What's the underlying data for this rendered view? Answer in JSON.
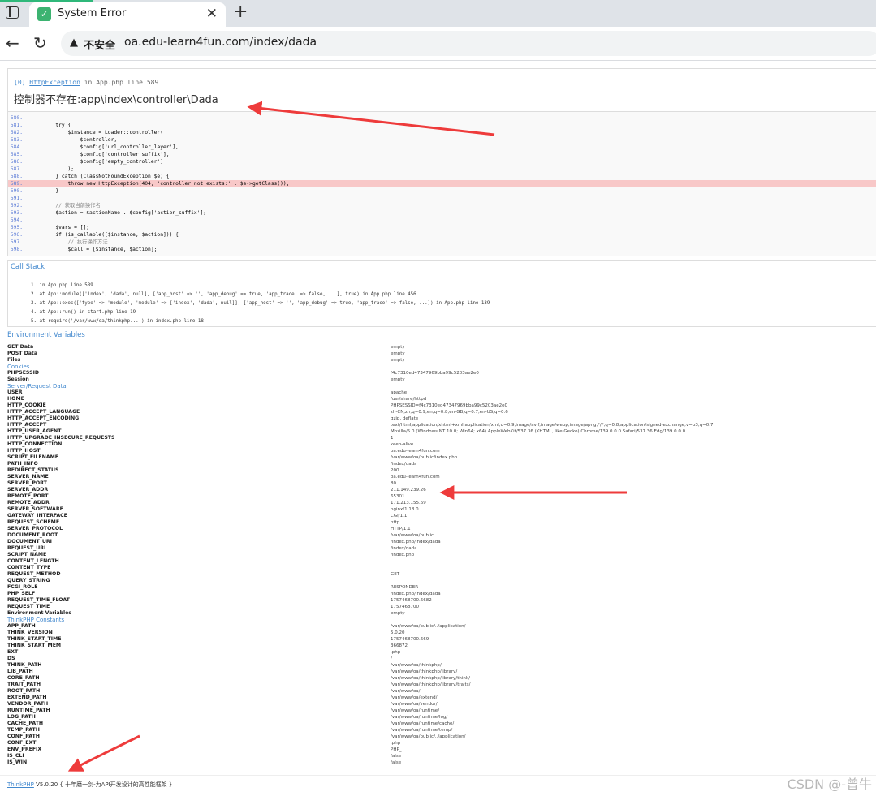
{
  "tab": {
    "title": "System Error",
    "close": "✕",
    "new": "+"
  },
  "toolbar": {
    "back": "←",
    "reload": "↻",
    "insecure": "不安全",
    "url": "oa.edu-learn4fun.com/index/dada"
  },
  "exception": {
    "index": "[0]",
    "class": "HttpException",
    "in": "in",
    "file": "App.php line 589",
    "message": "控制器不存在:app\\index\\controller\\Dada"
  },
  "source": [
    {
      "n": "580.",
      "t": ""
    },
    {
      "n": "581.",
      "t": "        try {"
    },
    {
      "n": "582.",
      "t": "            $instance = Loader::controller("
    },
    {
      "n": "583.",
      "t": "                $controller,"
    },
    {
      "n": "584.",
      "t": "                $config['url_controller_layer'],"
    },
    {
      "n": "585.",
      "t": "                $config['controller_suffix'],"
    },
    {
      "n": "586.",
      "t": "                $config['empty_controller']"
    },
    {
      "n": "587.",
      "t": "            );"
    },
    {
      "n": "588.",
      "t": "        } catch (ClassNotFoundException $e) {"
    },
    {
      "n": "589.",
      "t": "            throw new HttpException(404, 'controller not exists:' . $e->getClass());"
    },
    {
      "n": "590.",
      "t": "        }"
    },
    {
      "n": "591.",
      "t": ""
    },
    {
      "n": "592.",
      "t": "        // 获取当前操作名"
    },
    {
      "n": "593.",
      "t": "        $action = $actionName . $config['action_suffix'];"
    },
    {
      "n": "594.",
      "t": ""
    },
    {
      "n": "595.",
      "t": "        $vars = [];"
    },
    {
      "n": "596.",
      "t": "        if (is_callable([$instance, $action])) {"
    },
    {
      "n": "597.",
      "t": "            // 执行操作方法"
    },
    {
      "n": "598.",
      "t": "            $call = [$instance, $action];"
    }
  ],
  "callstack": {
    "title": "Call Stack",
    "items": [
      "1.  in App.php line 589",
      "2.  at App::module(['index', 'dada', null], ['app_host' => '', 'app_debug' => true, 'app_trace' => false, ...], true) in App.php line 456",
      "3.  at App::exec(['type' => 'module', 'module' => ['index', 'dada', null]], ['app_host' => '', 'app_debug' => true, 'app_trace' => false, ...]) in App.php line 139",
      "4.  at App::run() in start.php line 19",
      "5.  at require('/var/www/oa/thinkphp...') in index.php line 18"
    ]
  },
  "env_title": "Environment Variables",
  "env": [
    {
      "k": "GET Data",
      "v": "empty"
    },
    {
      "k": "POST Data",
      "v": "empty"
    },
    {
      "k": "Files",
      "v": "empty"
    },
    {
      "k": "Cookies",
      "v": "",
      "h": true
    },
    {
      "k": "PHPSESSID",
      "v": "f4c7310ed47347969bba99c5203ae2e0"
    },
    {
      "k": "Session",
      "v": "empty"
    },
    {
      "k": "Server/Request Data",
      "v": "",
      "h": true
    },
    {
      "k": "USER",
      "v": "apache"
    },
    {
      "k": "HOME",
      "v": "/usr/share/httpd"
    },
    {
      "k": "HTTP_COOKIE",
      "v": "PHPSESSID=f4c7310ed47347969bba99c5203ae2e0"
    },
    {
      "k": "HTTP_ACCEPT_LANGUAGE",
      "v": "zh-CN,zh;q=0.9,en;q=0.8,en-GB;q=0.7,en-US;q=0.6"
    },
    {
      "k": "HTTP_ACCEPT_ENCODING",
      "v": "gzip, deflate"
    },
    {
      "k": "HTTP_ACCEPT",
      "v": "text/html,application/xhtml+xml,application/xml;q=0.9,image/avif,image/webp,image/apng,*/*;q=0.8,application/signed-exchange;v=b3;q=0.7"
    },
    {
      "k": "HTTP_USER_AGENT",
      "v": "Mozilla/5.0 (Windows NT 10.0; Win64; x64) AppleWebKit/537.36 (KHTML, like Gecko) Chrome/139.0.0.0 Safari/537.36 Edg/139.0.0.0"
    },
    {
      "k": "HTTP_UPGRADE_INSECURE_REQUESTS",
      "v": "1"
    },
    {
      "k": "HTTP_CONNECTION",
      "v": "keep-alive"
    },
    {
      "k": "HTTP_HOST",
      "v": "oa.edu-learn4fun.com"
    },
    {
      "k": "SCRIPT_FILENAME",
      "v": "/var/www/oa/public/index.php"
    },
    {
      "k": "PATH_INFO",
      "v": "/index/dada"
    },
    {
      "k": "REDIRECT_STATUS",
      "v": "200"
    },
    {
      "k": "SERVER_NAME",
      "v": "oa.edu-learn4fun.com"
    },
    {
      "k": "SERVER_PORT",
      "v": "80"
    },
    {
      "k": "SERVER_ADDR",
      "v": "211.149.239.26"
    },
    {
      "k": "REMOTE_PORT",
      "v": "65301"
    },
    {
      "k": "REMOTE_ADDR",
      "v": "171.213.155.69"
    },
    {
      "k": "SERVER_SOFTWARE",
      "v": "nginx/1.18.0"
    },
    {
      "k": "GATEWAY_INTERFACE",
      "v": "CGI/1.1"
    },
    {
      "k": "REQUEST_SCHEME",
      "v": "http"
    },
    {
      "k": "SERVER_PROTOCOL",
      "v": "HTTP/1.1"
    },
    {
      "k": "DOCUMENT_ROOT",
      "v": "/var/www/oa/public"
    },
    {
      "k": "DOCUMENT_URI",
      "v": "/index.php/index/dada"
    },
    {
      "k": "REQUEST_URI",
      "v": "/index/dada"
    },
    {
      "k": "SCRIPT_NAME",
      "v": "/index.php"
    },
    {
      "k": "CONTENT_LENGTH",
      "v": ""
    },
    {
      "k": "CONTENT_TYPE",
      "v": ""
    },
    {
      "k": "REQUEST_METHOD",
      "v": "GET"
    },
    {
      "k": "QUERY_STRING",
      "v": ""
    },
    {
      "k": "FCGI_ROLE",
      "v": "RESPONDER"
    },
    {
      "k": "PHP_SELF",
      "v": "/index.php/index/dada"
    },
    {
      "k": "REQUEST_TIME_FLOAT",
      "v": "1757468700.6682"
    },
    {
      "k": "REQUEST_TIME",
      "v": "1757468700"
    },
    {
      "k": "Environment Variables",
      "v": "empty"
    },
    {
      "k": "ThinkPHP Constants",
      "v": "",
      "h": true
    },
    {
      "k": "APP_PATH",
      "v": "/var/www/oa/public/../application/"
    },
    {
      "k": "THINK_VERSION",
      "v": "5.0.20"
    },
    {
      "k": "THINK_START_TIME",
      "v": "1757468700.669"
    },
    {
      "k": "THINK_START_MEM",
      "v": "366872"
    },
    {
      "k": "EXT",
      "v": ".php"
    },
    {
      "k": "DS",
      "v": "/"
    },
    {
      "k": "THINK_PATH",
      "v": "/var/www/oa/thinkphp/"
    },
    {
      "k": "LIB_PATH",
      "v": "/var/www/oa/thinkphp/library/"
    },
    {
      "k": "CORE_PATH",
      "v": "/var/www/oa/thinkphp/library/think/"
    },
    {
      "k": "TRAIT_PATH",
      "v": "/var/www/oa/thinkphp/library/traits/"
    },
    {
      "k": "ROOT_PATH",
      "v": "/var/www/oa/"
    },
    {
      "k": "EXTEND_PATH",
      "v": "/var/www/oa/extend/"
    },
    {
      "k": "VENDOR_PATH",
      "v": "/var/www/oa/vendor/"
    },
    {
      "k": "RUNTIME_PATH",
      "v": "/var/www/oa/runtime/"
    },
    {
      "k": "LOG_PATH",
      "v": "/var/www/oa/runtime/log/"
    },
    {
      "k": "CACHE_PATH",
      "v": "/var/www/oa/runtime/cache/"
    },
    {
      "k": "TEMP_PATH",
      "v": "/var/www/oa/runtime/temp/"
    },
    {
      "k": "CONF_PATH",
      "v": "/var/www/oa/public/../application/"
    },
    {
      "k": "CONF_EXT",
      "v": ".php"
    },
    {
      "k": "ENV_PREFIX",
      "v": "PHP_"
    },
    {
      "k": "IS_CLI",
      "v": "false"
    },
    {
      "k": "IS_WIN",
      "v": "false"
    }
  ],
  "footer": {
    "brand": "ThinkPHP",
    "version": "V5.0.20",
    "slogan": "{ 十年磨一剑-为API开发设计的高性能框架 }"
  },
  "watermark": "CSDN @-曾牛",
  "colors": {
    "accent": "#4288ce",
    "highlight": "#f8c8c8",
    "annotation": "#ee3b3b"
  }
}
